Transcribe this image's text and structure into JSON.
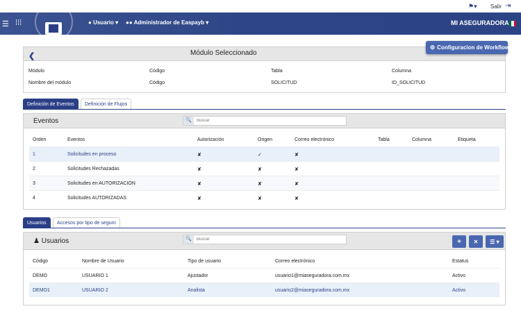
{
  "topbar": {
    "help_icon": "help-dropdown-icon",
    "logout_label": "Salir",
    "logout_icon": "exit-icon"
  },
  "nav": {
    "menu_icon": "hamburger-icon",
    "apps_icon": "apps-grid-icon",
    "user_menu": "Usuario",
    "admin_menu": "Administrador de Easpayb",
    "brand": "MI ASEGURADORA",
    "flag_colors": [
      "#006847",
      "#ffffff",
      "#ce1126"
    ]
  },
  "module": {
    "title": "Módulo Seleccionado",
    "workflow_button": "Configuracion de Workflow",
    "headers": [
      "Módulo",
      "Código",
      "Tabla",
      "Columna"
    ],
    "values": [
      "Nombre del módulo",
      "Código",
      "SOLICITUD",
      "ID_SOLICITUD"
    ]
  },
  "tabs1": [
    "Definición de Eventos",
    "Definición de Flujos"
  ],
  "events": {
    "title": "Eventos",
    "search_placeholder": "Buscar",
    "columns": [
      "Orden",
      "Eventos",
      "Autorización",
      "Origen",
      "Correo electrónico",
      "Tabla",
      "Columna",
      "Etiqueta"
    ],
    "rows": [
      {
        "orden": "1",
        "evento": "Solicitudes en proceso",
        "autorizacion": "✘",
        "origen": "✓",
        "correo": "✘"
      },
      {
        "orden": "2",
        "evento": "Solicitudes Rechazadas",
        "autorizacion": "✘",
        "origen": "✘",
        "correo": "✘"
      },
      {
        "orden": "3",
        "evento": "Solicitudes en AUTORIZACION",
        "autorizacion": "✘",
        "origen": "✘",
        "correo": "✘"
      },
      {
        "orden": "4",
        "evento": "Solicitudes AUTORIZADAS",
        "autorizacion": "✘",
        "origen": "✘",
        "correo": "✘"
      }
    ]
  },
  "tabs2": [
    "Usuarios",
    "Accesos por tipo de seguro"
  ],
  "users": {
    "title": "Usuarios",
    "search_placeholder": "Buscar",
    "buttons": {
      "add": "+",
      "remove": "✕",
      "menu": "☰ ▾"
    },
    "columns": [
      "Código",
      "Nombre de Usuario",
      "Tipo de usuario",
      "Correo electrónico",
      "Estatus"
    ],
    "rows": [
      {
        "codigo": "DEMO",
        "nombre": "USUARIO 1",
        "tipo": "Ajustador",
        "correo": "usuario1@miaseguradora.com.mx",
        "estatus": "Activo"
      },
      {
        "codigo": "DEMO1",
        "nombre": "USUARIO 2",
        "tipo": "Analista",
        "correo": "usuario2@miaseguradora.com.mx",
        "estatus": "Activo"
      }
    ]
  }
}
